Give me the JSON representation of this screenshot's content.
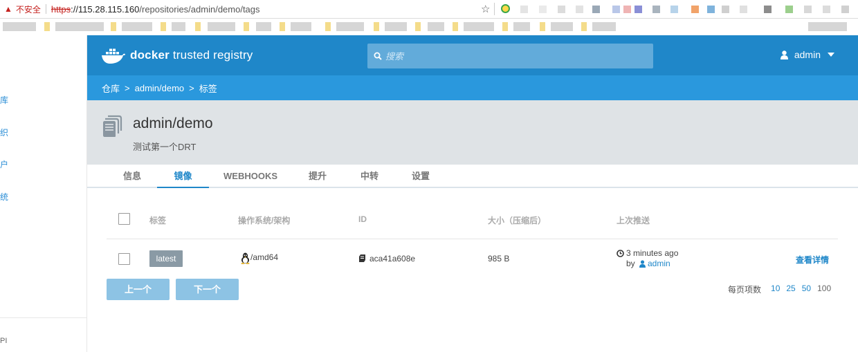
{
  "browser": {
    "security_label": "不安全",
    "url_protocol": "https",
    "url_host": "://115.28.115.160",
    "url_path": "/repositories/admin/demo/tags"
  },
  "sidebar": {
    "items": [
      {
        "label": "库"
      },
      {
        "label": "织"
      },
      {
        "label": "户"
      },
      {
        "label": "统"
      }
    ],
    "bottom_label": "PI"
  },
  "topnav": {
    "brand_docker": "docker",
    "brand_rest": " trusted registry",
    "search_placeholder": "搜索",
    "user": "admin"
  },
  "breadcrumb": {
    "items": [
      "仓库",
      "admin/demo",
      "标签"
    ],
    "separator": ">"
  },
  "repo": {
    "name": "admin/demo",
    "description": "测试第一个DRT"
  },
  "tabs": [
    {
      "label": "信息",
      "active": false
    },
    {
      "label": "镜像",
      "active": true
    },
    {
      "label": "WEBHOOKS",
      "active": false
    },
    {
      "label": "提升",
      "active": false
    },
    {
      "label": "中转",
      "active": false
    },
    {
      "label": "设置",
      "active": false
    }
  ],
  "table": {
    "columns": [
      "标签",
      "操作系统/架构",
      "ID",
      "大小（压缩后）",
      "上次推送"
    ],
    "rows": [
      {
        "tag": "latest",
        "os_arch": "/amd64",
        "id": "aca41a608e",
        "size": "985 B",
        "pushed_time": "3 minutes ago",
        "pushed_by_prefix": "by",
        "pushed_by": "admin",
        "action": "查看详情"
      }
    ]
  },
  "pagination": {
    "prev": "上一个",
    "next": "下一个",
    "per_page_label": "每页项数",
    "options": [
      "10",
      "25",
      "50",
      "100"
    ],
    "selected": "100"
  },
  "colors": {
    "topnav": "#1f87c9",
    "breadcrumb": "#2a98dd",
    "header_bg": "#dfe3e6",
    "tag_badge": "#8a9aa5",
    "pager_button": "#8dc3e4"
  }
}
